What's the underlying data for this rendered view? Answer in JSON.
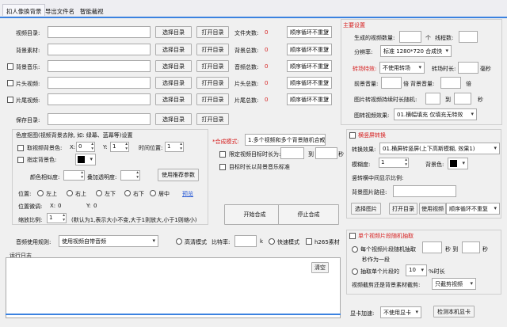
{
  "tabs": [
    "扣人像换背景",
    "导出文件名",
    "智能裁视"
  ],
  "rows": [
    {
      "label": "视频目录:",
      "count_label": "文件夹数:",
      "count": "0",
      "order": "顺序循环不重复"
    },
    {
      "label": "背景素材:",
      "count_label": "背景总数:",
      "count": "0",
      "order": "顺序循环不重复"
    },
    {
      "label": "背景音乐:",
      "count_label": "音频总数:",
      "count": "0",
      "order": "顺序循环不重复"
    },
    {
      "label": "片头视频:",
      "count_label": "片头总数:",
      "count": "0",
      "order": "顺序循环不重复"
    },
    {
      "label": "片尾视频:",
      "count_label": "片尾总数:",
      "count": "0",
      "order": "顺序循环不重复"
    },
    {
      "label": "保存目录:"
    }
  ],
  "buttons": {
    "select_dir": "选择目录",
    "open_dir": "打开目录"
  },
  "settings": {
    "title": "主要设置",
    "video_count_label": "生成的视频数量:",
    "unit_ge": "个",
    "threads_label": "线程数:",
    "resolution_label": "分辨率:",
    "resolution": "标准 1280*720 合成快",
    "transition_label": "转场特效:",
    "transition": "不使用转场",
    "transition_dur_label": "转场时长:",
    "ms": "毫秒",
    "fg_vol_label": "前景音量:",
    "times": "倍",
    "bg_vol_label": "背景音量:",
    "img_dur_label": "图片转视频持续时长随机:",
    "to": "到",
    "sec": "秒",
    "img_effect_label": "图转视频效果:",
    "img_effect": "01.横幅填充 仅填充无特效"
  },
  "chroma": {
    "title": "色度抠图(视频背景去除, 如: 绿幕、蓝幕等)设置",
    "pick_color": "取视频背景色:",
    "x": "X:",
    "y": "Y:",
    "x_val": "0",
    "y_val": "1",
    "time_pos": "时间位置:",
    "time_val": "1",
    "specify_color": "指定背景色:",
    "similarity": "颜色相似度:",
    "similarity_val": "",
    "blend": "叠加透明度:",
    "recommend_btn": "使用推荐参数",
    "position": "位置:",
    "positions": [
      "左上",
      "右上",
      "左下",
      "右下",
      "居中"
    ],
    "preview": "预览",
    "fine": "位置微调:",
    "fx": "X:",
    "fx_val": "0",
    "fy": "Y:",
    "fy_val": "0",
    "scale": "缩放比例:",
    "scale_val": "1",
    "scale_hint": "(默认为1,表示大小不变,大于1则放大,小于1则缩小)"
  },
  "compose": {
    "mode_label": "*合成模式:",
    "mode": "1.多个视频和多个背景随机合成",
    "limit_label": "限定视频目标时长为:",
    "to": "到",
    "sec": "秒",
    "music_std": "目标时长以背景音乐标准",
    "start": "开始合成",
    "stop": "停止合成"
  },
  "audio": {
    "label": "音频使用规则:",
    "rule": "使用视频自带音频",
    "high": "高清模式",
    "bitrate": "比特率:",
    "k": "k",
    "fast": "快速模式",
    "h265": "h265素材"
  },
  "log": {
    "title": "运行日志",
    "clear": "清空"
  },
  "vertical": {
    "title": "横竖屏转换",
    "effect_label": "转换效果:",
    "effect": "01.横屏转竖屏(上下高斯模糊, 效果1)",
    "blur_label": "模糊度:",
    "blur_val": "1",
    "bg_color": "背景色:",
    "ratio_label": "竖转横中间显示比例:",
    "bg_path": "背景图片路径:",
    "select_img": "选择图片",
    "open_dir": "打开目录",
    "use_video": "使用视频",
    "order": "顺序循环不重复"
  },
  "clip": {
    "title": "单个视频片段随机抽取",
    "per_video": "每个视频片段随机抽取",
    "to": "秒 到",
    "sec": "秒",
    "sec_in": "秒作为一段",
    "extract": "抽取单个片段的",
    "pct_val": "10",
    "pct": "%时长",
    "use_label": "视频截剪还是背景素材截剪:",
    "use": "只截剪视频"
  },
  "gpu": {
    "label": "显卡加速:",
    "value": "不使用显卡",
    "check": "检测本机显卡"
  }
}
